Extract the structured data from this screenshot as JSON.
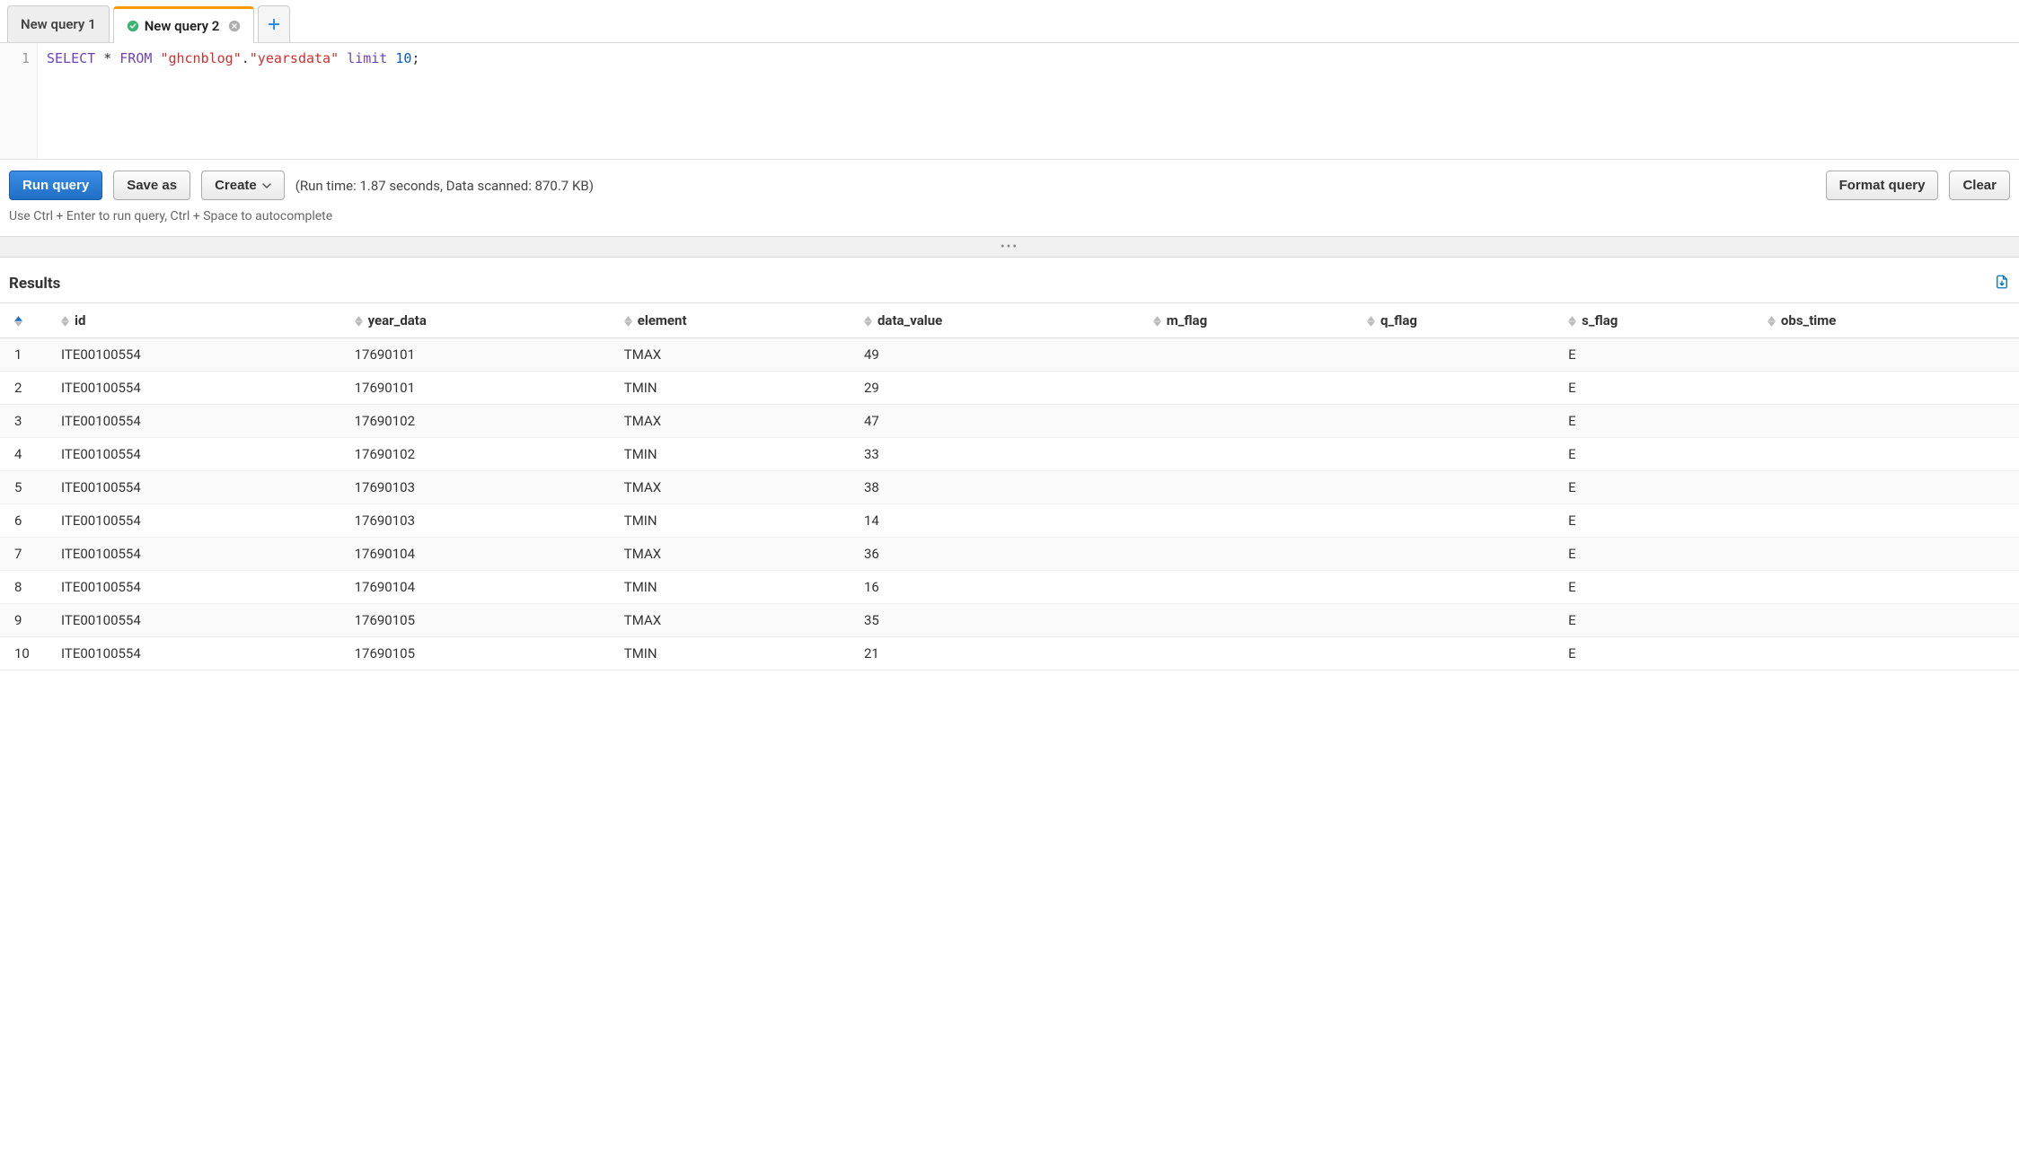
{
  "tabs": [
    {
      "label": "New query 1",
      "active": false
    },
    {
      "label": "New query 2",
      "active": true
    }
  ],
  "editor": {
    "line_number": "1",
    "sql_tokens": {
      "select": "SELECT",
      "star": "*",
      "from": "FROM",
      "db": "\"ghcnblog\"",
      "dot": ".",
      "table": "\"yearsdata\"",
      "limit": "limit",
      "limit_n": "10",
      "semicolon": ";"
    }
  },
  "toolbar": {
    "run_label": "Run query",
    "save_as_label": "Save as",
    "create_label": "Create",
    "run_stats": "(Run time: 1.87 seconds, Data scanned: 870.7 KB)",
    "format_label": "Format query",
    "clear_label": "Clear"
  },
  "hint": "Use Ctrl + Enter to run query, Ctrl + Space to autocomplete",
  "divider_grip": "•••",
  "results": {
    "title": "Results",
    "columns": [
      "",
      "id",
      "year_data",
      "element",
      "data_value",
      "m_flag",
      "q_flag",
      "s_flag",
      "obs_time"
    ],
    "rows": [
      {
        "n": "1",
        "id": "ITE00100554",
        "year_data": "17690101",
        "element": "TMAX",
        "data_value": "49",
        "m_flag": "",
        "q_flag": "",
        "s_flag": "E",
        "obs_time": ""
      },
      {
        "n": "2",
        "id": "ITE00100554",
        "year_data": "17690101",
        "element": "TMIN",
        "data_value": "29",
        "m_flag": "",
        "q_flag": "",
        "s_flag": "E",
        "obs_time": ""
      },
      {
        "n": "3",
        "id": "ITE00100554",
        "year_data": "17690102",
        "element": "TMAX",
        "data_value": "47",
        "m_flag": "",
        "q_flag": "",
        "s_flag": "E",
        "obs_time": ""
      },
      {
        "n": "4",
        "id": "ITE00100554",
        "year_data": "17690102",
        "element": "TMIN",
        "data_value": "33",
        "m_flag": "",
        "q_flag": "",
        "s_flag": "E",
        "obs_time": ""
      },
      {
        "n": "5",
        "id": "ITE00100554",
        "year_data": "17690103",
        "element": "TMAX",
        "data_value": "38",
        "m_flag": "",
        "q_flag": "",
        "s_flag": "E",
        "obs_time": ""
      },
      {
        "n": "6",
        "id": "ITE00100554",
        "year_data": "17690103",
        "element": "TMIN",
        "data_value": "14",
        "m_flag": "",
        "q_flag": "",
        "s_flag": "E",
        "obs_time": ""
      },
      {
        "n": "7",
        "id": "ITE00100554",
        "year_data": "17690104",
        "element": "TMAX",
        "data_value": "36",
        "m_flag": "",
        "q_flag": "",
        "s_flag": "E",
        "obs_time": ""
      },
      {
        "n": "8",
        "id": "ITE00100554",
        "year_data": "17690104",
        "element": "TMIN",
        "data_value": "16",
        "m_flag": "",
        "q_flag": "",
        "s_flag": "E",
        "obs_time": ""
      },
      {
        "n": "9",
        "id": "ITE00100554",
        "year_data": "17690105",
        "element": "TMAX",
        "data_value": "35",
        "m_flag": "",
        "q_flag": "",
        "s_flag": "E",
        "obs_time": ""
      },
      {
        "n": "10",
        "id": "ITE00100554",
        "year_data": "17690105",
        "element": "TMIN",
        "data_value": "21",
        "m_flag": "",
        "q_flag": "",
        "s_flag": "E",
        "obs_time": ""
      }
    ]
  }
}
